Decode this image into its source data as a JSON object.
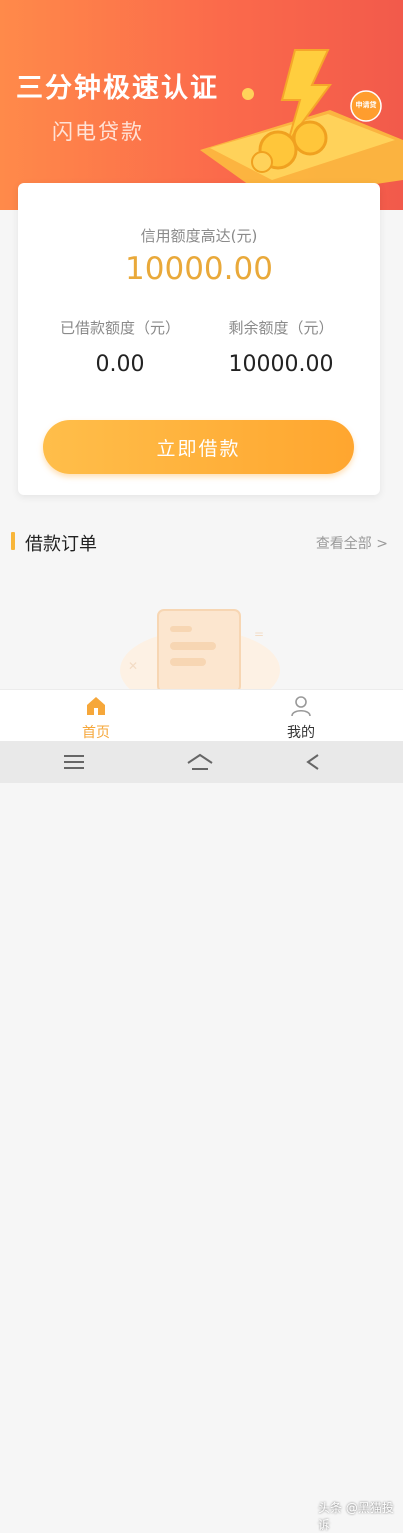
{
  "hero": {
    "title": "三分钟极速认证",
    "subtitle": "闪电贷款",
    "badge": "申请贷"
  },
  "card": {
    "limit_label": "信用额度高达(元)",
    "limit_value": "10000.00",
    "borrowed_label": "已借款额度（元）",
    "borrowed_value": "0.00",
    "remaining_label": "剩余额度（元）",
    "remaining_value": "10000.00",
    "loan_button": "立即借款"
  },
  "orders": {
    "title": "借款订单",
    "view_all": "查看全部 >"
  },
  "tabbar": {
    "home": "首页",
    "mine": "我的"
  },
  "watermark": "头条 @黑猫投诉",
  "icons": {
    "home": "home-icon",
    "mine": "user-icon",
    "menu": "menu-icon",
    "home_nav": "home-nav-icon",
    "back": "back-icon"
  },
  "colors": {
    "accent": "#f6a73a",
    "hero": "#fb6a4b",
    "limit": "#e9a93a"
  }
}
